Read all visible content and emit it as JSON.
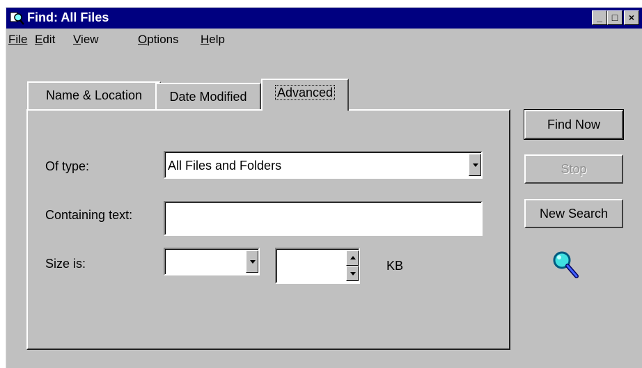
{
  "window": {
    "title": "Find: All Files",
    "icon": "find-icon"
  },
  "title_buttons": {
    "minimize": "_",
    "maximize": "□",
    "close": "×"
  },
  "menu": [
    {
      "label": "File",
      "mnemonic": "F"
    },
    {
      "label": "Edit",
      "mnemonic": "E"
    },
    {
      "label": "View",
      "mnemonic": "V"
    },
    {
      "label": "Options",
      "mnemonic": "O"
    },
    {
      "label": "Help",
      "mnemonic": "H"
    }
  ],
  "tabs": [
    {
      "label": "Name & Location",
      "selected": false
    },
    {
      "label": "Date Modified",
      "selected": false
    },
    {
      "label": "Advanced",
      "selected": true
    }
  ],
  "form": {
    "of_type_label": "Of type:",
    "of_type_value": "All Files and Folders",
    "containing_text_label": "Containing text:",
    "containing_text_value": "",
    "size_label": "Size is:",
    "size_qualifier_value": "",
    "size_amount_value": "",
    "size_unit": "KB"
  },
  "buttons": {
    "find_now": "Find Now",
    "stop": "Stop",
    "new_search": "New Search"
  },
  "colors": {
    "titlebar": "#000080",
    "face": "#c0c0c0",
    "disabled_text": "#909090"
  }
}
